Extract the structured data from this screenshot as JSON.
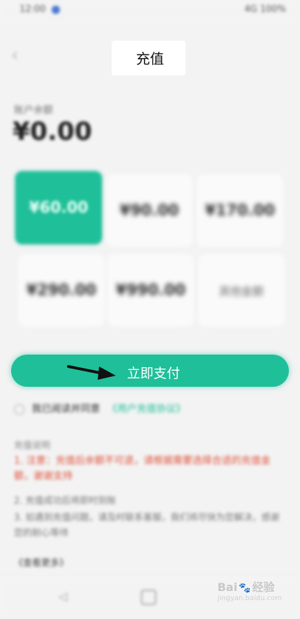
{
  "status_bar": {
    "time": "12:00",
    "right": "4G 100%"
  },
  "header": {
    "title": "充值",
    "back_icon": "back-arrow-icon"
  },
  "balance": {
    "label": "账户余额",
    "value": "¥0.00"
  },
  "amounts": [
    {
      "label": "¥60.00",
      "selected": true
    },
    {
      "label": "¥90.00",
      "selected": false
    },
    {
      "label": "¥170.00",
      "selected": false
    },
    {
      "label": "¥290.00",
      "selected": false
    },
    {
      "label": "¥990.00",
      "selected": false
    },
    {
      "label": "其他金额",
      "selected": false
    }
  ],
  "pay_button": {
    "label": "立即支付"
  },
  "agreement": {
    "text": "我已阅读并同意",
    "link": "《用户充值协议》"
  },
  "notes": {
    "title": "充值说明",
    "red": "1. 注意：充值后余额不可退，请根据需要选择合适的充值金额，谢谢支持",
    "line1": "2. 充值成功后将即时到账",
    "line2": "3. 如遇到充值问题，请及时联系客服，我们将尽快为您解决，感谢您的耐心等待",
    "more": "《查看更多》"
  },
  "nav": {
    "back_icon": "nav-back-icon",
    "home_icon": "nav-home-icon"
  },
  "watermark": {
    "text": "Bai",
    "suffix": "经验",
    "sub": "jingyan.baidu.com"
  },
  "colors": {
    "accent": "#1fbf9a",
    "warning": "#e0533c"
  }
}
